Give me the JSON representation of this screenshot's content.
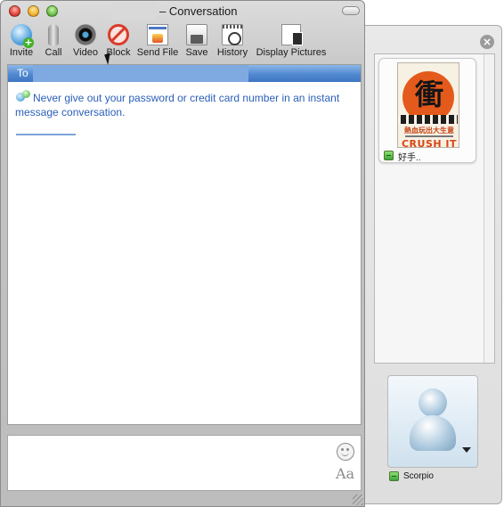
{
  "window": {
    "title": "– Conversation"
  },
  "toolbar": {
    "items": [
      {
        "label": "Invite",
        "icon": "invite-icon"
      },
      {
        "label": "Call",
        "icon": "microphone-icon"
      },
      {
        "label": "Video",
        "icon": "webcam-icon"
      },
      {
        "label": "Block",
        "icon": "block-icon"
      },
      {
        "label": "Send File",
        "icon": "send-file-icon"
      },
      {
        "label": "Save",
        "icon": "save-icon"
      },
      {
        "label": "History",
        "icon": "history-icon"
      },
      {
        "label": "Display Pictures",
        "icon": "display-pictures-icon"
      }
    ]
  },
  "conversation": {
    "to_label": "To",
    "warning": "Never give out your password or credit card number in an instant message conversation."
  },
  "input": {
    "font_button_label": "Aa"
  },
  "drawer": {
    "close_glyph": "×",
    "contact": {
      "name": "好手..",
      "status": "online",
      "picture": {
        "glyph": "衝",
        "subtitle": "熱血玩出大生意",
        "title": "CRUSH IT"
      }
    },
    "me": {
      "name": "Scorpio",
      "status": "online"
    }
  },
  "colors": {
    "to_bar": "#4e86cf",
    "warning_text": "#2b5fb8",
    "status_online": "#3da43a"
  }
}
